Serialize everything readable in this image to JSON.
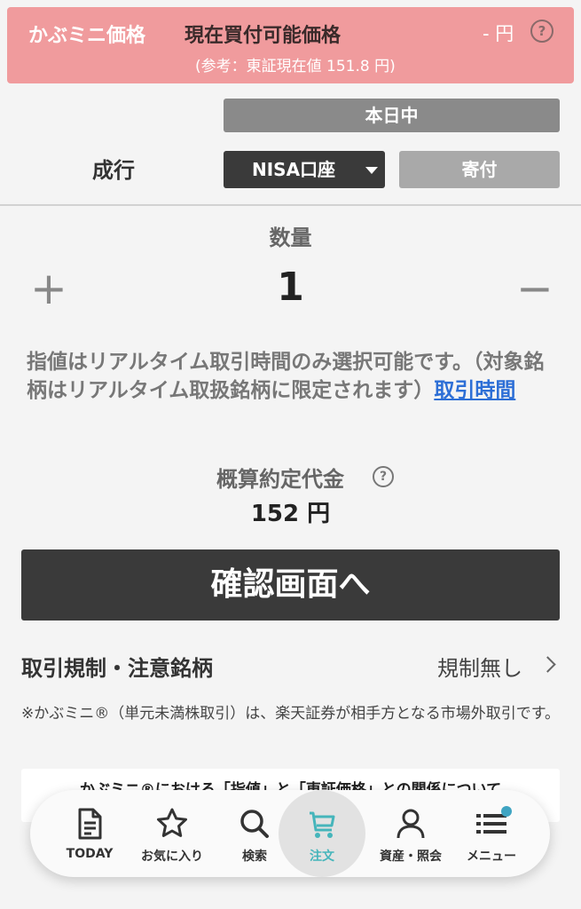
{
  "banner": {
    "title": "かぶミニ価格",
    "label": "現在買付可能価格",
    "value": "- 円",
    "help": "?",
    "reference": "(参考：東証現在値  151.8 円)"
  },
  "session_button": "本日中",
  "order_type": "成行",
  "account": {
    "selected": "NISA口座"
  },
  "donate_button": "寄付",
  "quantity": {
    "label": "数量",
    "plus": "+",
    "value": "1",
    "minus": "−"
  },
  "notice": {
    "text": "指値はリアルタイム取引時間のみ選択可能です。（対象銘柄はリアルタイム取扱銘柄に限定されます）",
    "link": "取引時間"
  },
  "estimate": {
    "label": "概算約定代金",
    "help": "?",
    "value": "152 円"
  },
  "confirm_button": "確認画面へ",
  "restrictions": {
    "label": "取引規制・注意銘柄",
    "value": "規制無し"
  },
  "footnote": "※かぶミニ®（単元未満株取引）は、楽天証券が相手方となる市場外取引です。",
  "info_card": "かぶミニ®における「指値」と「東証価格」との関係について",
  "nav": {
    "items": [
      {
        "label": "TODAY",
        "icon": "document-icon"
      },
      {
        "label": "お気に入り",
        "icon": "star-icon"
      },
      {
        "label": "検索",
        "icon": "search-icon"
      },
      {
        "label": "注文",
        "icon": "cart-icon",
        "active": true
      },
      {
        "label": "資産・照会",
        "icon": "person-icon"
      },
      {
        "label": "メニュー",
        "icon": "menu-icon"
      }
    ],
    "active_color": "#45b5bb"
  },
  "colors": {
    "banner": "#f09b9d",
    "button_dark": "#3a3a3a",
    "button_gray": "#8a8a8a",
    "link": "#2d6fd6"
  }
}
